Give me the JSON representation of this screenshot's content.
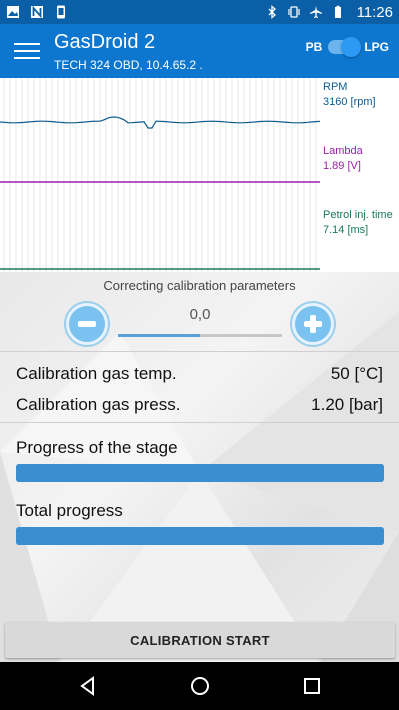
{
  "status_bar": {
    "time": "11:26",
    "left_icons": [
      "image-icon",
      "n-icon",
      "phone-device-icon"
    ],
    "right_icons": [
      "bluetooth-icon",
      "vibrate-icon",
      "airplane-mode-icon",
      "battery-icon"
    ]
  },
  "app_bar": {
    "title": "GasDroid 2",
    "subtitle": "TECH 324 OBD, 10.4.65.2 .",
    "fuel_left": "PB",
    "fuel_right": "LPG",
    "fuel_toggle_on": true
  },
  "chart_data": {
    "type": "line",
    "series": [
      {
        "name": "RPM",
        "value_text": "3160 [rpm]",
        "color": "#0c5a8e"
      },
      {
        "name": "Lambda",
        "value_text": "1.89 [V]",
        "color": "#9b1fa8"
      },
      {
        "name": "Petrol inj. time",
        "value_text": "7.14 [ms]",
        "color": "#187a58"
      }
    ],
    "grid": true
  },
  "correction": {
    "title": "Correcting calibration parameters",
    "value": "0,0",
    "slider_fraction": 0.5
  },
  "readings": [
    {
      "label": "Calibration gas temp.",
      "value": "50 [°C]"
    },
    {
      "label": "Calibration gas press.",
      "value": "1.20 [bar]"
    }
  ],
  "progress": {
    "stage_label": "Progress of the stage",
    "stage_fraction": 1.0,
    "total_label": "Total progress",
    "total_fraction": 1.0
  },
  "actions": {
    "start_label": "CALIBRATION START"
  },
  "colors": {
    "app_bar": "#0d77cf",
    "status_bar": "#0a5fa6",
    "progress": "#3b8fd0"
  }
}
